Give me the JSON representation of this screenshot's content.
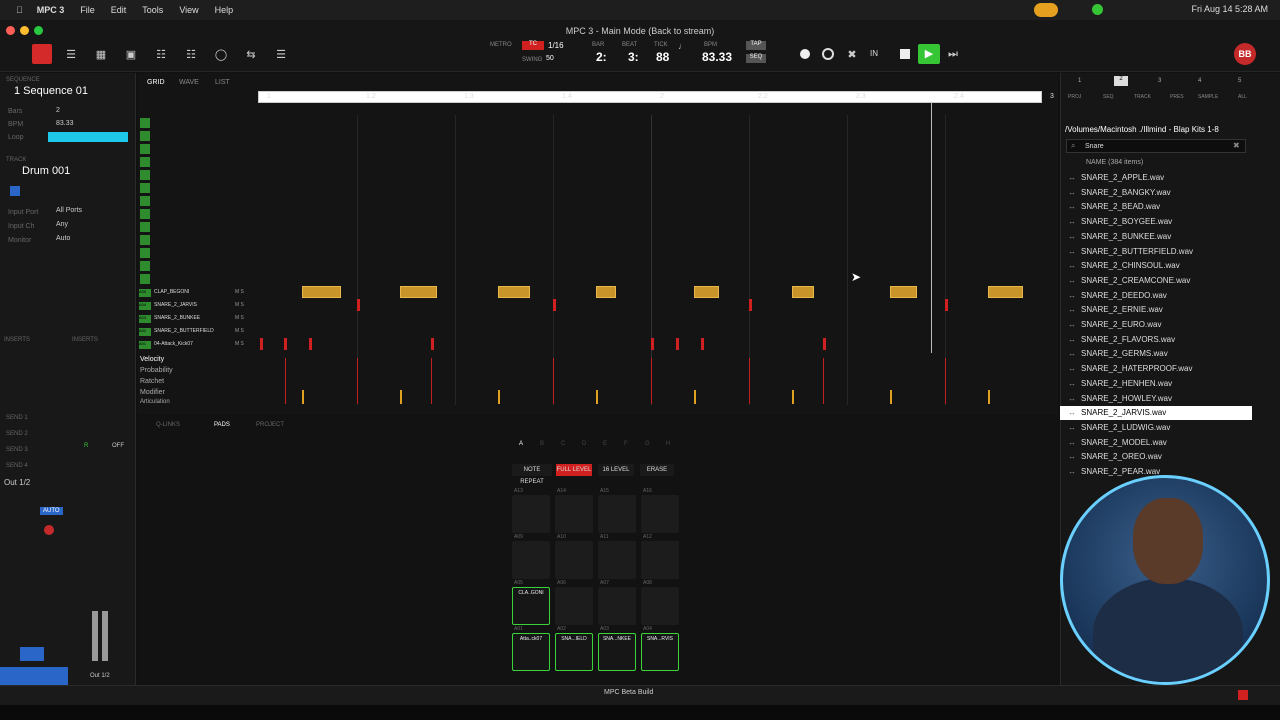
{
  "menubar": {
    "app": "MPC 3",
    "items": [
      "File",
      "Edit",
      "Tools",
      "View",
      "Help"
    ],
    "clock": "Fri Aug 14  5:28 AM"
  },
  "window": {
    "title": "MPC 3 - Main Mode (Back to stream)"
  },
  "transport": {
    "metro_label": "METRO",
    "tc_label": "TC",
    "tc_value": "1/16",
    "swing_label": "SWING",
    "swing_value": "50",
    "bar_label": "BAR",
    "bar": "2:",
    "beat_label": "BEAT",
    "beat": "3:",
    "tick_label": "TICK",
    "tick": "88",
    "bpm_label": "BPM",
    "bpm": "83.33",
    "tap_label": "TAP",
    "seq_label": "SEQ",
    "in_label": "IN",
    "avatar": "BB"
  },
  "left": {
    "sequence_section": "SEQUENCE",
    "sequence": "1 Sequence 01",
    "bars_label": "Bars",
    "bars": "2",
    "bpm_label": "BPM",
    "bpm": "83.33",
    "loop_label": "Loop",
    "track_section": "TRACK",
    "track": "Drum 001",
    "input_port_label": "Input Port",
    "input_port": "All Ports",
    "input_ch_label": "Input Ch",
    "input_ch": "Any",
    "monitor_label": "Monitor",
    "monitor": "Auto",
    "inserts1": "INSERTS",
    "inserts2": "INSERTS",
    "sends": [
      "SEND 1",
      "SEND 2",
      "SEND 3",
      "SEND 4"
    ],
    "out": "Out 1/2",
    "r_label": "R",
    "off_label": "OFF",
    "auto_label": "AUTO",
    "out_bottom": "Out 1/2"
  },
  "grid": {
    "tabs": [
      "GRID",
      "WAVE",
      "LIST"
    ],
    "ruler": [
      "1",
      "1.2",
      "1.3",
      "1.4",
      "2",
      "2.2",
      "2.3",
      "2.4",
      "3"
    ],
    "tracks": [
      {
        "num": "A05",
        "name": "CLAP_BEGONI"
      },
      {
        "num": "A04",
        "name": "SNARE_2_JARVIS"
      },
      {
        "num": "A03",
        "name": "SNARE_2_BUNKEE"
      },
      {
        "num": "A02",
        "name": "SNARE_2_BUTTERFIELD"
      },
      {
        "num": "A01",
        "name": "04-Attack_Kick07"
      }
    ],
    "params": [
      "Velocity",
      "Probability",
      "Ratchet",
      "Modifier",
      "Articulation"
    ]
  },
  "pads": {
    "tabs": [
      "Q-LINKS",
      "PADS",
      "PROJECT"
    ],
    "banks": [
      "A",
      "B",
      "C",
      "D",
      "E",
      "F",
      "G",
      "H"
    ],
    "buttons": [
      "NOTE REPEAT",
      "FULL LEVEL",
      "16 LEVEL",
      "ERASE"
    ],
    "row_labels": [
      [
        "A13",
        "A14",
        "A15",
        "A16"
      ],
      [
        "A09",
        "A10",
        "A11",
        "A12"
      ],
      [
        "A05",
        "A06",
        "A07",
        "A08"
      ],
      [
        "A01",
        "A02",
        "A03",
        "A04"
      ]
    ],
    "pad_a05": "CLA..GONI",
    "bottom": [
      "Atta..ck07",
      "SNA...IELD",
      "SNA...NKEE",
      "SNA...RVIS"
    ]
  },
  "browser": {
    "tabs": [
      "1",
      "2",
      "3",
      "4",
      "5"
    ],
    "cats": [
      "PROJ",
      "SEQ",
      "TRACK",
      "PRES",
      "SAMPLE",
      "ALL"
    ],
    "path": "/Volumes/Macintosh ./Illmind - Blap Kits 1-8",
    "search": "Snare",
    "header": "NAME (384 items)",
    "files": [
      "SNARE_2_APPLE.wav",
      "SNARE_2_BANGKY.wav",
      "SNARE_2_BEAD.wav",
      "SNARE_2_BOYGEE.wav",
      "SNARE_2_BUNKEE.wav",
      "SNARE_2_BUTTERFIELD.wav",
      "SNARE_2_CHINSOUL.wav",
      "SNARE_2_CREAMCONE.wav",
      "SNARE_2_DEEDO.wav",
      "SNARE_2_ERNIE.wav",
      "SNARE_2_EURO.wav",
      "SNARE_2_FLAVORS.wav",
      "SNARE_2_GERMS.wav",
      "SNARE_2_HATERPROOF.wav",
      "SNARE_2_HENHEN.wav",
      "SNARE_2_HOWLEY.wav",
      "SNARE_2_JARVIS.wav",
      "SNARE_2_LUDWIG.wav",
      "SNARE_2_MODEL.wav",
      "SNARE_2_OREO.wav",
      "SNARE_2_PEAR.wav"
    ],
    "selected_index": 16
  },
  "footer": {
    "build": "MPC Beta Build"
  },
  "colors": {
    "accent_green": "#3ad43a",
    "note_gold": "#c9952a",
    "note_red": "#d02020",
    "cyan": "#1ec8e8"
  }
}
